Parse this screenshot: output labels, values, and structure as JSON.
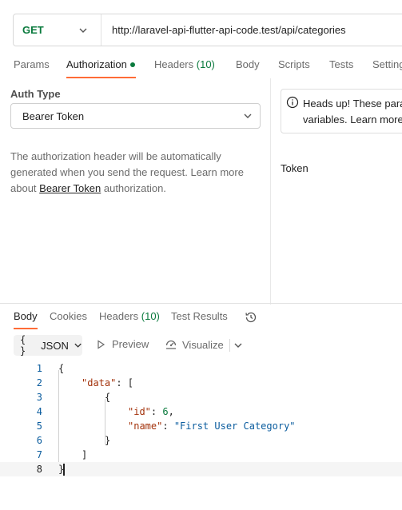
{
  "request": {
    "method": "GET",
    "url": "http://laravel-api-flutter-api-code.test/api/categories"
  },
  "request_tabs": {
    "params": "Params",
    "authorization": "Authorization",
    "headers": "Headers",
    "headers_count": "(10)",
    "body": "Body",
    "scripts": "Scripts",
    "tests": "Tests",
    "settings": "Settings"
  },
  "auth": {
    "type_label": "Auth Type",
    "type_value": "Bearer Token",
    "desc_prefix": "The authorization header will be automatically generated when you send the request. Learn more about ",
    "desc_link": "Bearer Token",
    "desc_suffix": " authorization.",
    "headsup_line1": "Heads up! These parameters hold sensitive data.",
    "headsup_line2": "variables. Learn more",
    "token_label": "Token"
  },
  "response_tabs": {
    "body": "Body",
    "cookies": "Cookies",
    "headers": "Headers",
    "headers_count": "(10)",
    "test_results": "Test Results"
  },
  "toolbar": {
    "format": "JSON",
    "preview": "Preview",
    "visualize": "Visualize"
  },
  "code_lines": {
    "l1": "1",
    "l2": "2",
    "l3": "3",
    "l4": "4",
    "l5": "5",
    "l6": "6",
    "l7": "7",
    "l8": "8",
    "open_brace": "{",
    "data_key": "\"data\"",
    "data_rest": ": [",
    "obj_open": "{",
    "id_key": "\"id\"",
    "id_colon": ": ",
    "id_value": "6",
    "id_comma": ",",
    "name_key": "\"name\"",
    "name_colon": ": ",
    "name_value": "\"First User Category\"",
    "obj_close": "}",
    "arr_close": "]",
    "close_brace": "}"
  },
  "colors": {
    "accent": "#ff6c37",
    "method_green": "#0a7a3d",
    "json_key": "#a3320b",
    "json_string": "#0a5c9e"
  },
  "icons": [
    "chevron-down-icon",
    "info-icon",
    "history-icon",
    "play-icon",
    "visualize-icon",
    "braces-icon"
  ]
}
